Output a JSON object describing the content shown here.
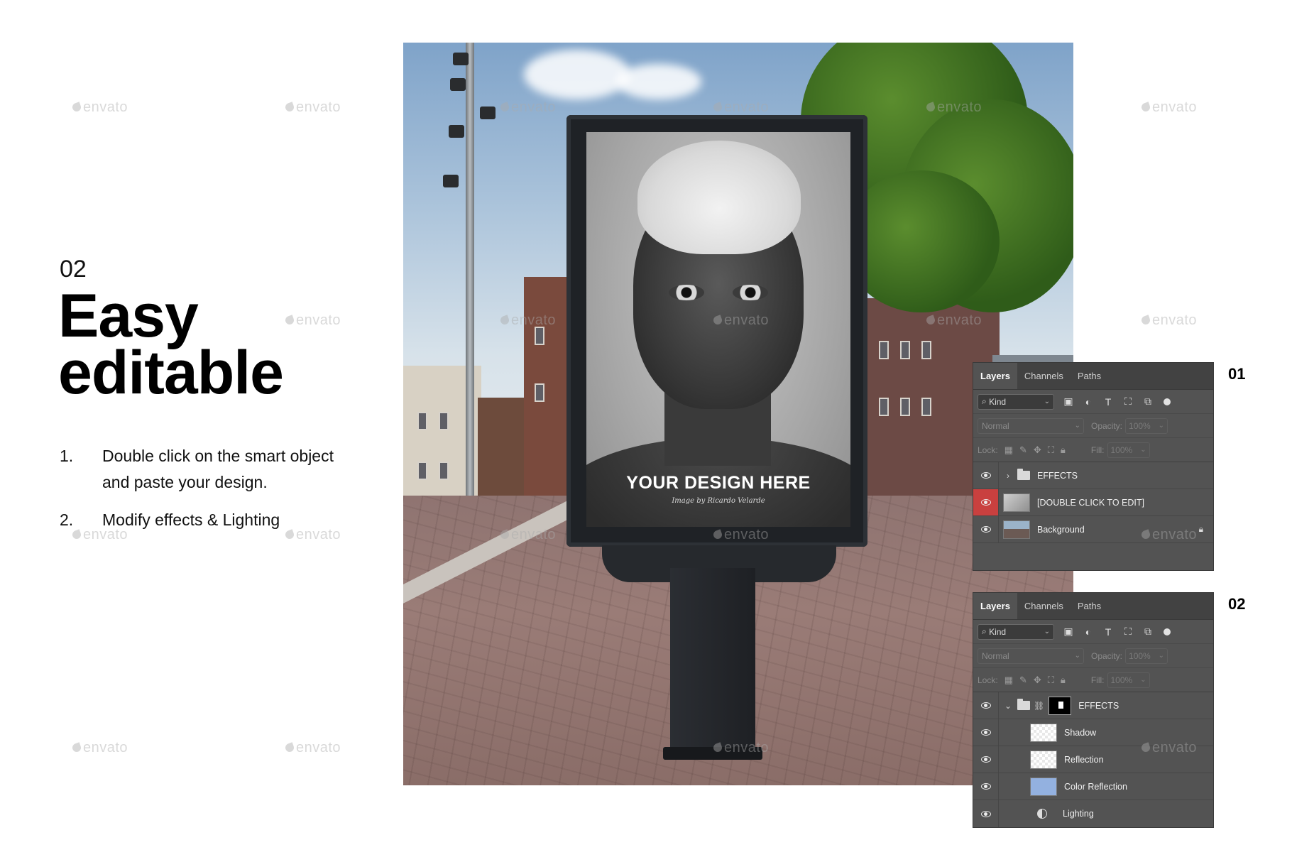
{
  "watermark": "envato",
  "left": {
    "step_number": "02",
    "headline_line1": "Easy",
    "headline_line2": "editable",
    "steps": [
      {
        "n": "1.",
        "text": "Double click on the smart object and paste your design."
      },
      {
        "n": "2.",
        "text": "Modify effects & Lighting"
      }
    ]
  },
  "poster": {
    "title": "YOUR DESIGN HERE",
    "credit": "Image by Ricardo Velarde"
  },
  "panel1": {
    "label": "01",
    "tabs": [
      "Layers",
      "Channels",
      "Paths"
    ],
    "kind": "Kind",
    "blend_mode": "Normal",
    "opacity_label": "Opacity:",
    "opacity_value": "100%",
    "lock_label": "Lock:",
    "fill_label": "Fill:",
    "fill_value": "100%",
    "layers": [
      {
        "name": "EFFECTS",
        "type": "group-collapsed"
      },
      {
        "name": "[DOUBLE CLICK TO EDIT]",
        "type": "smart-object",
        "highlight": "#c9403f"
      },
      {
        "name": "Background",
        "type": "photo",
        "locked": true
      }
    ]
  },
  "panel2": {
    "label": "02",
    "tabs": [
      "Layers",
      "Channels",
      "Paths"
    ],
    "kind": "Kind",
    "blend_mode": "Normal",
    "opacity_label": "Opacity:",
    "opacity_value": "100%",
    "lock_label": "Lock:",
    "fill_label": "Fill:",
    "fill_value": "100%",
    "layers": [
      {
        "name": "EFFECTS",
        "type": "group-expanded"
      },
      {
        "name": "Shadow",
        "type": "transparent"
      },
      {
        "name": "Reflection",
        "type": "transparent"
      },
      {
        "name": "Color Reflection",
        "type": "solid",
        "color": "#93b1e0"
      },
      {
        "name": "Lighting",
        "type": "adjustment"
      }
    ]
  },
  "colors": {
    "panel_bg": "#535353",
    "tab_bar": "#424242",
    "eye_highlight": "#c9403f"
  }
}
